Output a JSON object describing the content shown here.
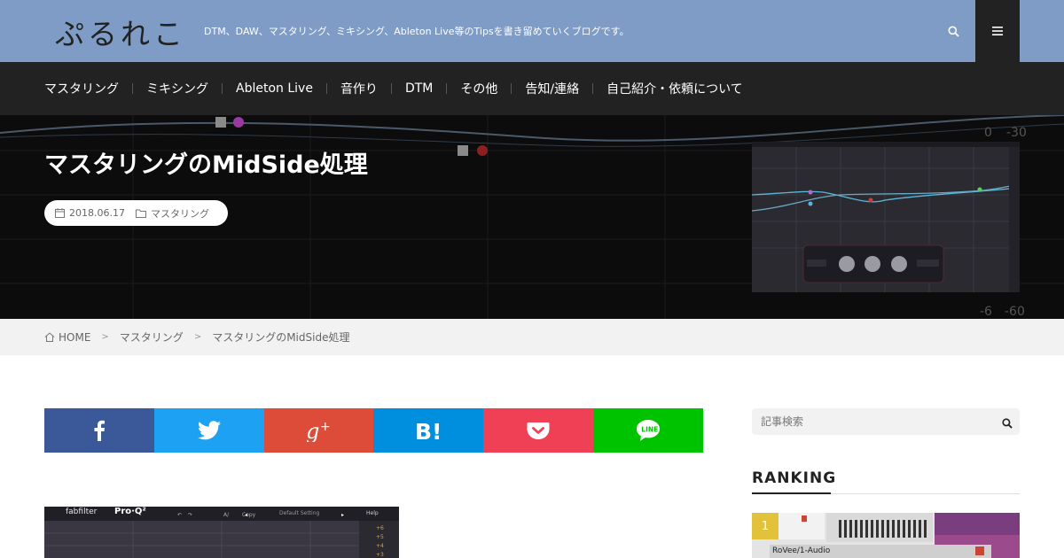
{
  "site": {
    "logo": "ぷるれこ",
    "tagline": "DTM、DAW、マスタリング、ミキシング、Ableton Live等のTipsを書き留めていくブログです。"
  },
  "header": {
    "search_icon": "search-icon",
    "menu_icon": "hamburger-menu-icon"
  },
  "nav": {
    "items": [
      "マスタリング",
      "ミキシング",
      "Ableton Live",
      "音作り",
      "DTM",
      "その他",
      "告知/連絡",
      "自己紹介・依頼について"
    ]
  },
  "post": {
    "title": "マスタリングのMidSide処理",
    "date": "2018.06.17",
    "category": "マスタリング"
  },
  "breadcrumb": {
    "home": "HOME",
    "category": "マスタリング",
    "current": "マスタリングのMidSide処理"
  },
  "share": {
    "buttons": [
      {
        "name": "facebook",
        "color": "#3b5998"
      },
      {
        "name": "twitter",
        "color": "#1da1f2"
      },
      {
        "name": "google-plus",
        "color": "#dd4b39"
      },
      {
        "name": "hatena-bookmark",
        "color": "#008fde"
      },
      {
        "name": "pocket",
        "color": "#ef4056"
      },
      {
        "name": "line",
        "color": "#00c300"
      }
    ]
  },
  "article_image": {
    "brand": "fabfilter",
    "product": "Pro·Q²",
    "help": "Help",
    "preset": "Default Setting"
  },
  "sidebar": {
    "search_placeholder": "記事検索",
    "ranking_title": "RANKING",
    "ranking": [
      {
        "rank": "1",
        "caption": "RoVee/1-Audio"
      }
    ]
  },
  "colors": {
    "header_bg": "#7e9cc6",
    "nav_bg": "#222222",
    "hero_bg": "#0c0c0d",
    "rank_badge": "#e2c23a"
  }
}
